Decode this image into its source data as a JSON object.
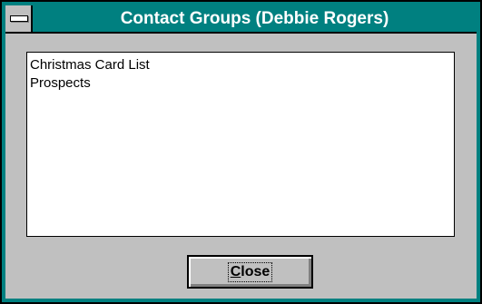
{
  "window": {
    "title": "Contact Groups (Debbie Rogers)"
  },
  "groups_list": {
    "items": [
      "Christmas Card List",
      "Prospects"
    ]
  },
  "buttons": {
    "close_mnemonic": "C",
    "close_rest": "lose"
  },
  "colors": {
    "title_bar": "#008080",
    "face": "#c0c0c0",
    "list_background": "#ffffff"
  }
}
